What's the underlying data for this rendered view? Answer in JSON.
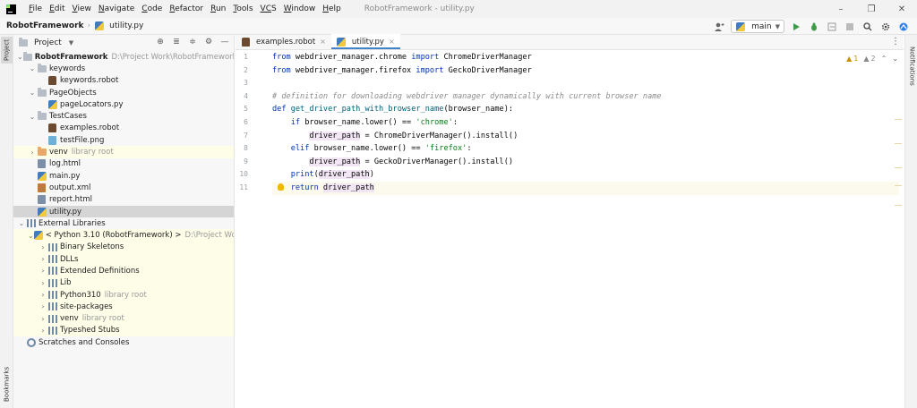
{
  "window": {
    "title": "RobotFramework - utility.py",
    "menu": [
      {
        "u": "F",
        "rest": "ile"
      },
      {
        "u": "E",
        "rest": "dit"
      },
      {
        "u": "V",
        "rest": "iew"
      },
      {
        "u": "N",
        "rest": "avigate"
      },
      {
        "u": "C",
        "rest": "ode"
      },
      {
        "u": "R",
        "rest": "efactor"
      },
      {
        "u": "R",
        "rest": "un"
      },
      {
        "u": "T",
        "rest": "ools"
      },
      {
        "u": "VC",
        "rest": "S"
      },
      {
        "u": "W",
        "rest": "indow"
      },
      {
        "u": "H",
        "rest": "elp"
      }
    ],
    "controls": {
      "minimize": "–",
      "restore": "❐",
      "close": "✕"
    }
  },
  "navbar": {
    "project": "RobotFramework",
    "file": "utility.py",
    "branch": "main"
  },
  "left_strip": {
    "project_tab": "Project",
    "bookmarks_tab": "Bookmarks"
  },
  "right_strip": {
    "notifications_tab": "Notifications"
  },
  "project_panel": {
    "title": "Project",
    "tree": [
      {
        "indent": 0,
        "chev": "v",
        "icon": "folder",
        "label": "RobotFramework",
        "bold": true,
        "muted": "D:\\Project Work\\RobotFramework"
      },
      {
        "indent": 1,
        "chev": "v",
        "icon": "folder",
        "label": "keywords"
      },
      {
        "indent": 2,
        "chev": "",
        "icon": "robot",
        "label": "keywords.robot"
      },
      {
        "indent": 1,
        "chev": "v",
        "icon": "folder",
        "label": "PageObjects"
      },
      {
        "indent": 2,
        "chev": "",
        "icon": "py",
        "label": "pageLocators.py"
      },
      {
        "indent": 1,
        "chev": "v",
        "icon": "folder",
        "label": "TestCases"
      },
      {
        "indent": 2,
        "chev": "",
        "icon": "robot",
        "label": "examples.robot"
      },
      {
        "indent": 2,
        "chev": "",
        "icon": "png",
        "label": "testFile.png"
      },
      {
        "indent": 1,
        "chev": ">",
        "icon": "excl",
        "label": "venv",
        "muted": "library root",
        "lib": true
      },
      {
        "indent": 1,
        "chev": "",
        "icon": "html",
        "label": "log.html"
      },
      {
        "indent": 1,
        "chev": "",
        "icon": "py",
        "label": "main.py"
      },
      {
        "indent": 1,
        "chev": "",
        "icon": "xml",
        "label": "output.xml"
      },
      {
        "indent": 1,
        "chev": "",
        "icon": "html",
        "label": "report.html"
      },
      {
        "indent": 1,
        "chev": "",
        "icon": "py",
        "label": "utility.py",
        "selected": true
      },
      {
        "indent": 0,
        "chev": "v",
        "icon": "lib",
        "label": "External Libraries"
      },
      {
        "indent": 1,
        "chev": "v",
        "icon": "py",
        "label": "< Python 3.10 (RobotFramework) >",
        "muted": "D:\\Project Work\\Robo",
        "lib": true
      },
      {
        "indent": 2,
        "chev": ">",
        "icon": "lib",
        "label": "Binary Skeletons",
        "lib": true
      },
      {
        "indent": 2,
        "chev": ">",
        "icon": "lib",
        "label": "DLLs",
        "lib": true
      },
      {
        "indent": 2,
        "chev": ">",
        "icon": "lib",
        "label": "Extended Definitions",
        "lib": true
      },
      {
        "indent": 2,
        "chev": ">",
        "icon": "lib",
        "label": "Lib",
        "lib": true
      },
      {
        "indent": 2,
        "chev": ">",
        "icon": "lib",
        "label": "Python310",
        "muted": "library root",
        "lib": true
      },
      {
        "indent": 2,
        "chev": ">",
        "icon": "lib",
        "label": "site-packages",
        "lib": true
      },
      {
        "indent": 2,
        "chev": ">",
        "icon": "lib",
        "label": "venv",
        "muted": "library root",
        "lib": true
      },
      {
        "indent": 2,
        "chev": ">",
        "icon": "lib",
        "label": "Typeshed Stubs",
        "lib": true
      },
      {
        "indent": 0,
        "chev": "",
        "icon": "scratch",
        "label": "Scratches and Consoles"
      }
    ]
  },
  "editor_tabs": [
    {
      "label": "examples.robot",
      "icon": "robot",
      "active": false
    },
    {
      "label": "utility.py",
      "icon": "py",
      "active": true
    }
  ],
  "inspections": {
    "warnings": "1",
    "weak_warnings": "2"
  },
  "code_lines": [
    [
      {
        "t": "from ",
        "c": "kw"
      },
      {
        "t": "webdriver_manager.chrome ",
        "c": ""
      },
      {
        "t": "import ",
        "c": "kw"
      },
      {
        "t": "ChromeDriverManager",
        "c": ""
      }
    ],
    [
      {
        "t": "from ",
        "c": "kw"
      },
      {
        "t": "webdriver_manager.firefox ",
        "c": ""
      },
      {
        "t": "import ",
        "c": "kw"
      },
      {
        "t": "GeckoDriverManager",
        "c": ""
      }
    ],
    [],
    [
      {
        "t": "# definition for downloading webdriver manager dynamically with current browser name",
        "c": "cm"
      }
    ],
    [
      {
        "t": "def ",
        "c": "kw"
      },
      {
        "t": "get_driver_path_with_browser_name",
        "c": "fn"
      },
      {
        "t": "(browser_name):",
        "c": ""
      }
    ],
    [
      {
        "t": "    ",
        "c": ""
      },
      {
        "t": "if ",
        "c": "kw"
      },
      {
        "t": "browser_name.lower() == ",
        "c": ""
      },
      {
        "t": "'chrome'",
        "c": "st"
      },
      {
        "t": ":",
        "c": ""
      }
    ],
    [
      {
        "t": "        ",
        "c": ""
      },
      {
        "t": "driver_path",
        "c": "vr"
      },
      {
        "t": " = ChromeDriverManager().install()",
        "c": ""
      }
    ],
    [
      {
        "t": "    ",
        "c": ""
      },
      {
        "t": "elif ",
        "c": "kw"
      },
      {
        "t": "browser_name.lower() == ",
        "c": ""
      },
      {
        "t": "'firefox'",
        "c": "st"
      },
      {
        "t": ":",
        "c": ""
      }
    ],
    [
      {
        "t": "        ",
        "c": ""
      },
      {
        "t": "driver_path",
        "c": "vr"
      },
      {
        "t": " = GeckoDriverManager().install()",
        "c": ""
      }
    ],
    [
      {
        "t": "    ",
        "c": ""
      },
      {
        "t": "print",
        "c": "kw"
      },
      {
        "t": "(",
        "c": ""
      },
      {
        "t": "driver_path",
        "c": "vr"
      },
      {
        "t": ")",
        "c": ""
      }
    ],
    [
      {
        "t": "    ",
        "c": ""
      },
      {
        "t": "return ",
        "c": "kw"
      },
      {
        "t": "driver_path",
        "c": "vr"
      }
    ]
  ],
  "line_numbers": [
    "1",
    "2",
    "3",
    "4",
    "5",
    "6",
    "7",
    "8",
    "9",
    "10",
    "11"
  ],
  "current_line": 11
}
